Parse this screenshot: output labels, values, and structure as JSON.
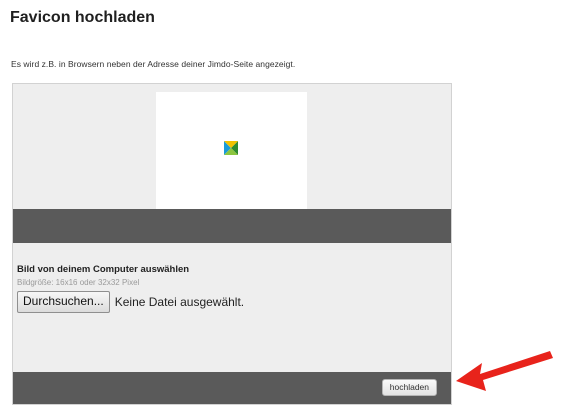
{
  "header": {
    "title": "Favicon hochladen",
    "subtitle": "Es wird z.B. in Browsern neben der Adresse deiner Jimdo-Seite angezeigt."
  },
  "preview": {
    "icon": "jimdo-favicon-icon"
  },
  "upload": {
    "label": "Bild von deinem Computer auswählen",
    "hint": "Bildgröße: 16x16 oder 32x32 Pixel",
    "browse_label": "Durchsuchen...",
    "file_status": "Keine Datei ausgewählt.",
    "submit_label": "hochladen"
  },
  "annotation": {
    "icon": "red-arrow-icon",
    "color": "#e8231b"
  },
  "colors": {
    "panel_bg": "#eeeeee",
    "bar_dark": "#5a5a5a"
  }
}
